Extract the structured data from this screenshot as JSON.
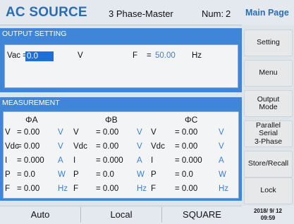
{
  "header": {
    "title": "AC SOURCE",
    "mode": "3 Phase-Master",
    "num_label": "Num:",
    "num_value": "2"
  },
  "output_setting": {
    "title": "OUTPUT SETTING",
    "vac_label": "Vac =",
    "vac_value": "0.0",
    "vac_unit": "V",
    "f_label": "F",
    "f_eq": "=",
    "f_value": "50.00",
    "f_unit": "Hz"
  },
  "measurement": {
    "title": "MEASUREMENT",
    "phases": [
      "ΦA",
      "ΦB",
      "ΦC"
    ],
    "rows": [
      {
        "label": "V",
        "cells": [
          {
            "value": "= 0.00",
            "unit": "V"
          },
          {
            "value": "= 0.00",
            "unit": "V"
          },
          {
            "value": "= 0.00",
            "unit": "V"
          }
        ]
      },
      {
        "label": "Vdc",
        "cells": [
          {
            "value": "= 0.00",
            "unit": "V"
          },
          {
            "value": "= 0.00",
            "unit": "V"
          },
          {
            "value": "= 0.00",
            "unit": "V"
          }
        ]
      },
      {
        "label": "I",
        "cells": [
          {
            "value": "= 0.000",
            "unit": "A"
          },
          {
            "value": "= 0.000",
            "unit": "A"
          },
          {
            "value": "= 0.000",
            "unit": "A"
          }
        ]
      },
      {
        "label": "P",
        "cells": [
          {
            "value": "= 0.0",
            "unit": "W"
          },
          {
            "value": "= 0.0",
            "unit": "W"
          },
          {
            "value": "= 0.0",
            "unit": "W"
          }
        ]
      },
      {
        "label": "F",
        "cells": [
          {
            "value": "= 0.00",
            "unit": "Hz"
          },
          {
            "value": "= 0.00",
            "unit": "Hz"
          },
          {
            "value": "= 0.00",
            "unit": "Hz"
          }
        ]
      }
    ]
  },
  "status": {
    "run_mode": "Auto",
    "control": "Local",
    "waveform": "SQUARE"
  },
  "sidebar": {
    "title": "Main Page",
    "buttons": [
      {
        "line1": "Setting",
        "line2": "",
        "line3": ""
      },
      {
        "line1": "Menu",
        "line2": "",
        "line3": ""
      },
      {
        "line1": "Output",
        "line2": "Mode",
        "line3": ""
      },
      {
        "line1": "Parallel",
        "line2": "Serial",
        "line3": "3-Phase"
      },
      {
        "line1": "Store/Recall",
        "line2": "",
        "line3": ""
      },
      {
        "line1": "Lock",
        "line2": "",
        "line3": ""
      }
    ],
    "date": "2018/ 9/ 12",
    "time": "09:59"
  },
  "colors": {
    "accent": "#3f86d8",
    "title_blue": "#2b6db3",
    "unit_blue": "#3d7fc9",
    "highlight": "#1e6fd8"
  }
}
